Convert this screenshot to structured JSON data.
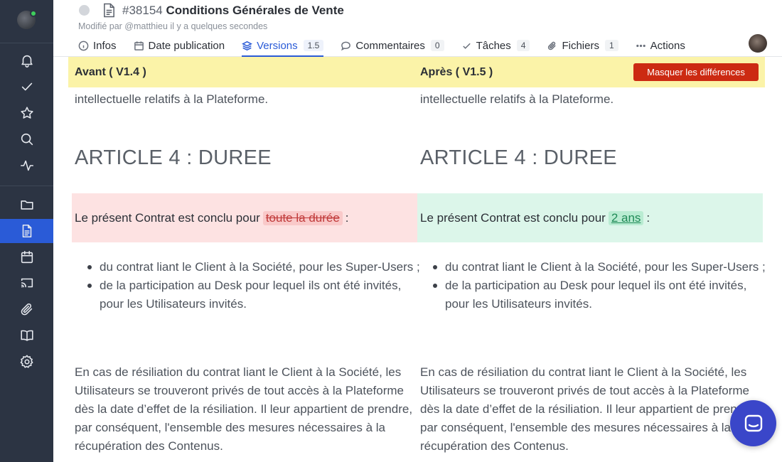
{
  "sidebar": {
    "items": [
      {
        "name": "bell-icon"
      },
      {
        "name": "check-icon"
      },
      {
        "name": "star-icon"
      },
      {
        "name": "search-icon"
      },
      {
        "name": "activity-icon"
      },
      {
        "name": "folder-icon"
      },
      {
        "name": "document-icon",
        "active": true
      },
      {
        "name": "calendar-icon"
      },
      {
        "name": "cast-icon"
      },
      {
        "name": "paperclip-icon"
      },
      {
        "name": "book-icon"
      },
      {
        "name": "gear-icon"
      }
    ],
    "accent": "#2a5bd7"
  },
  "header": {
    "doc_number": "#38154",
    "doc_title": "Conditions Générales de Vente",
    "modified": "Modifié par  @matthieu il y a quelques secondes"
  },
  "tabs": [
    {
      "label": "Infos",
      "icon": "info-icon",
      "badge": ""
    },
    {
      "label": "Date publication",
      "icon": "calendar-icon",
      "badge": ""
    },
    {
      "label": "Versions",
      "icon": "layers-icon",
      "badge": "1.5",
      "active": true
    },
    {
      "label": "Commentaires",
      "icon": "comment-icon",
      "badge": "0"
    },
    {
      "label": "Tâches",
      "icon": "check-icon",
      "badge": "4"
    },
    {
      "label": "Fichiers",
      "icon": "paperclip-icon",
      "badge": "1"
    },
    {
      "label": "Actions",
      "icon": "more-icon",
      "badge": ""
    }
  ],
  "compare": {
    "before_label": "Avant ( V1.4 )",
    "after_label": "Après ( V1.5 )",
    "hide_button": "Masquer les différences",
    "bar_color": "#fbf3a8",
    "button_color": "#cc2a12"
  },
  "content": {
    "intro_line": "intellectuelle relatifs à la Plateforme.",
    "heading": "ARTICLE 4 : DUREE",
    "diff_prefix": "Le présent Contrat est conclu pour",
    "diff_deleted": "toute la durée",
    "diff_inserted": "2 ans",
    "diff_suffix": ":",
    "bullets": [
      "du contrat liant le Client à la Société, pour les Super-Users ;",
      "de la participation au Desk pour lequel ils ont été invités, pour les Utilisateurs invités."
    ],
    "paragraph": "En cas de résiliation du contrat liant le Client à la Société, les Utilisateurs se trouveront privés de tout accès à la Plateforme dès la date d’effet de la résiliation. Il leur appartient de prendre, par conséquent, l'ensemble des  mesures nécessaires à la récupération des Contenus."
  }
}
